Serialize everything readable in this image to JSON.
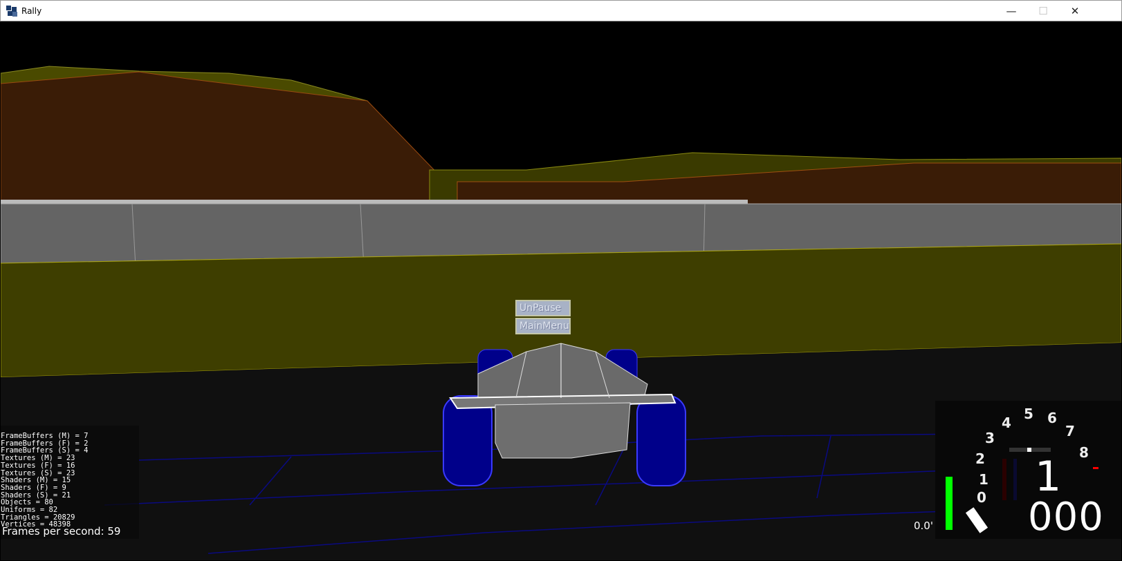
{
  "window": {
    "title": "Rally",
    "minimize": "—",
    "maximize": "☐",
    "close": "✕"
  },
  "pause_menu": {
    "unpause": "UnPause",
    "main_menu": "MainMenu"
  },
  "stats": [
    "FrameBuffers (M) = 7",
    "FrameBuffers (F) = 2",
    "FrameBuffers (S) = 4",
    "Textures (M) = 23",
    "Textures (F) = 16",
    "Textures (S) = 23",
    "Shaders (M) = 15",
    "Shaders (F) = 9",
    "Shaders (S) = 21",
    "Objects = 80",
    "Uniforms = 82",
    "Triangles = 20829",
    "Vertices = 48398"
  ],
  "fps": "Frames per second: 59",
  "hud": {
    "rpm_labels": [
      "0",
      "1",
      "2",
      "3",
      "4",
      "5",
      "6",
      "7",
      "8"
    ],
    "gear": "1",
    "speed": "000",
    "odometer": "0.0'",
    "throttle_fraction": 0.75,
    "colors": {
      "throttle": "#00ff00",
      "redline": "#ff0000"
    }
  }
}
